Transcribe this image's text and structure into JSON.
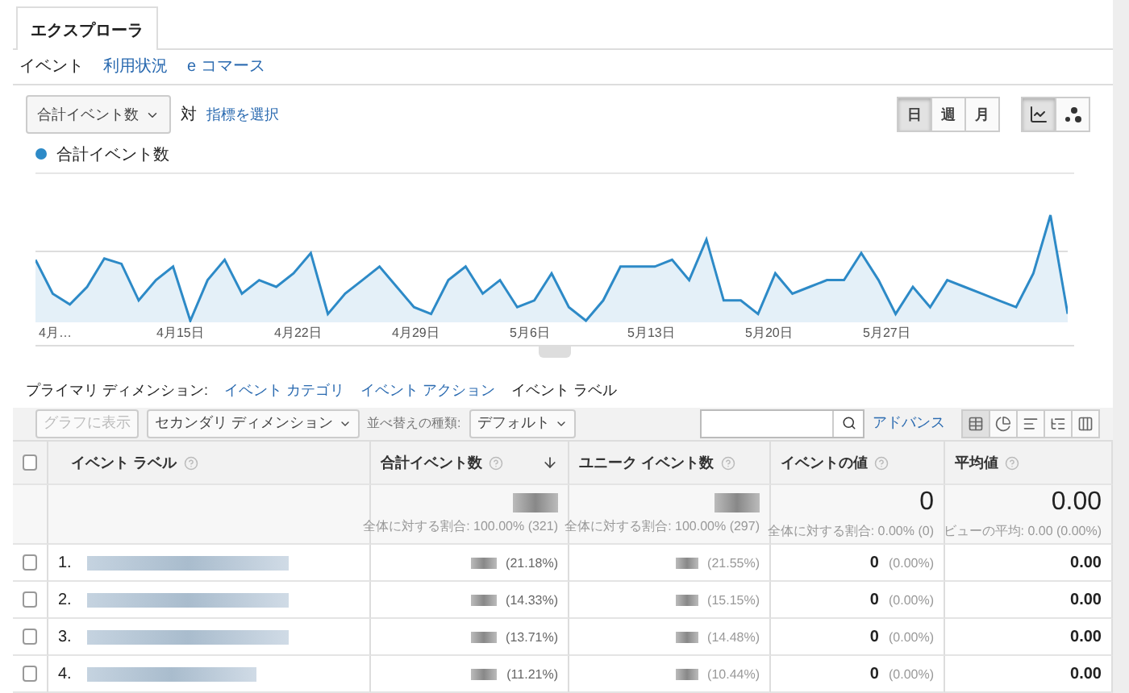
{
  "tabs": [
    {
      "label": "エクスプローラ",
      "selected": true
    }
  ],
  "subnav": [
    {
      "label": "イベント",
      "selected": true
    },
    {
      "label": "利用状況",
      "selected": false
    },
    {
      "label": "e コマース",
      "selected": false
    }
  ],
  "metric_controls": {
    "metric": "合計イベント数",
    "versus": "対",
    "select_metric": "指標を選択"
  },
  "period_buttons": [
    {
      "label": "日",
      "selected": true
    },
    {
      "label": "週",
      "selected": false
    },
    {
      "label": "月",
      "selected": false
    }
  ],
  "chart_types": [
    {
      "kind": "line",
      "selected": true
    },
    {
      "kind": "motion",
      "selected": false
    }
  ],
  "legend": {
    "label": "合計イベント数",
    "color": "#2d8ac7"
  },
  "x_labels": [
    "4月…",
    "4月15日",
    "4月22日",
    "4月29日",
    "5月6日",
    "5月13日",
    "5月20日",
    "5月27日"
  ],
  "primary_dimension": {
    "label": "プライマリ ディメンション:",
    "items": [
      {
        "label": "イベント カテゴリ",
        "selected": false
      },
      {
        "label": "イベント アクション",
        "selected": false
      },
      {
        "label": "イベント ラベル",
        "selected": true
      }
    ]
  },
  "toolbar": {
    "plot_button": {
      "label": "グラフに表示",
      "disabled": true
    },
    "secondary_dimension": "セカンダリ ディメンション",
    "sort_label": "並べ替えの種類:",
    "sort_value": "デフォルト",
    "advanced": "アドバンス",
    "views": [
      {
        "kind": "table",
        "selected": true
      },
      {
        "kind": "pie",
        "selected": false
      },
      {
        "kind": "bars",
        "selected": false
      },
      {
        "kind": "comparison",
        "selected": false
      },
      {
        "kind": "pivot",
        "selected": false
      }
    ]
  },
  "table": {
    "columns": [
      {
        "label": "イベント ラベル",
        "sorted": false
      },
      {
        "label": "合計イベント数",
        "sorted": true
      },
      {
        "label": "ユニーク イベント数",
        "sorted": false
      },
      {
        "label": "イベントの値",
        "sorted": false
      },
      {
        "label": "平均値",
        "sorted": false
      }
    ],
    "select_all": {
      "checked": false
    },
    "totals": [
      {
        "note": "全体に対する割合: 100.00% (321)"
      },
      {
        "note": "全体に対する割合: 100.00% (297)"
      },
      {
        "value": "0",
        "note": "全体に対する割合: 0.00% (0)"
      },
      {
        "value": "0.00",
        "note": "ビューの平均: 0.00 (0.00%)"
      }
    ],
    "rows": [
      {
        "index": "1.",
        "checked": false,
        "total_pct": "(21.18%)",
        "unique_pct": "(21.55%)",
        "value": "0",
        "value_pct": "(0.00%)",
        "avg": "0.00"
      },
      {
        "index": "2.",
        "checked": false,
        "total_pct": "(14.33%)",
        "unique_pct": "(15.15%)",
        "value": "0",
        "value_pct": "(0.00%)",
        "avg": "0.00"
      },
      {
        "index": "3.",
        "checked": false,
        "total_pct": "(13.71%)",
        "unique_pct": "(14.48%)",
        "value": "0",
        "value_pct": "(0.00%)",
        "avg": "0.00"
      },
      {
        "index": "4.",
        "checked": false,
        "total_pct": "(11.21%)",
        "unique_pct": "(10.44%)",
        "value": "0",
        "value_pct": "(0.00%)",
        "avg": "0.00"
      }
    ]
  }
}
